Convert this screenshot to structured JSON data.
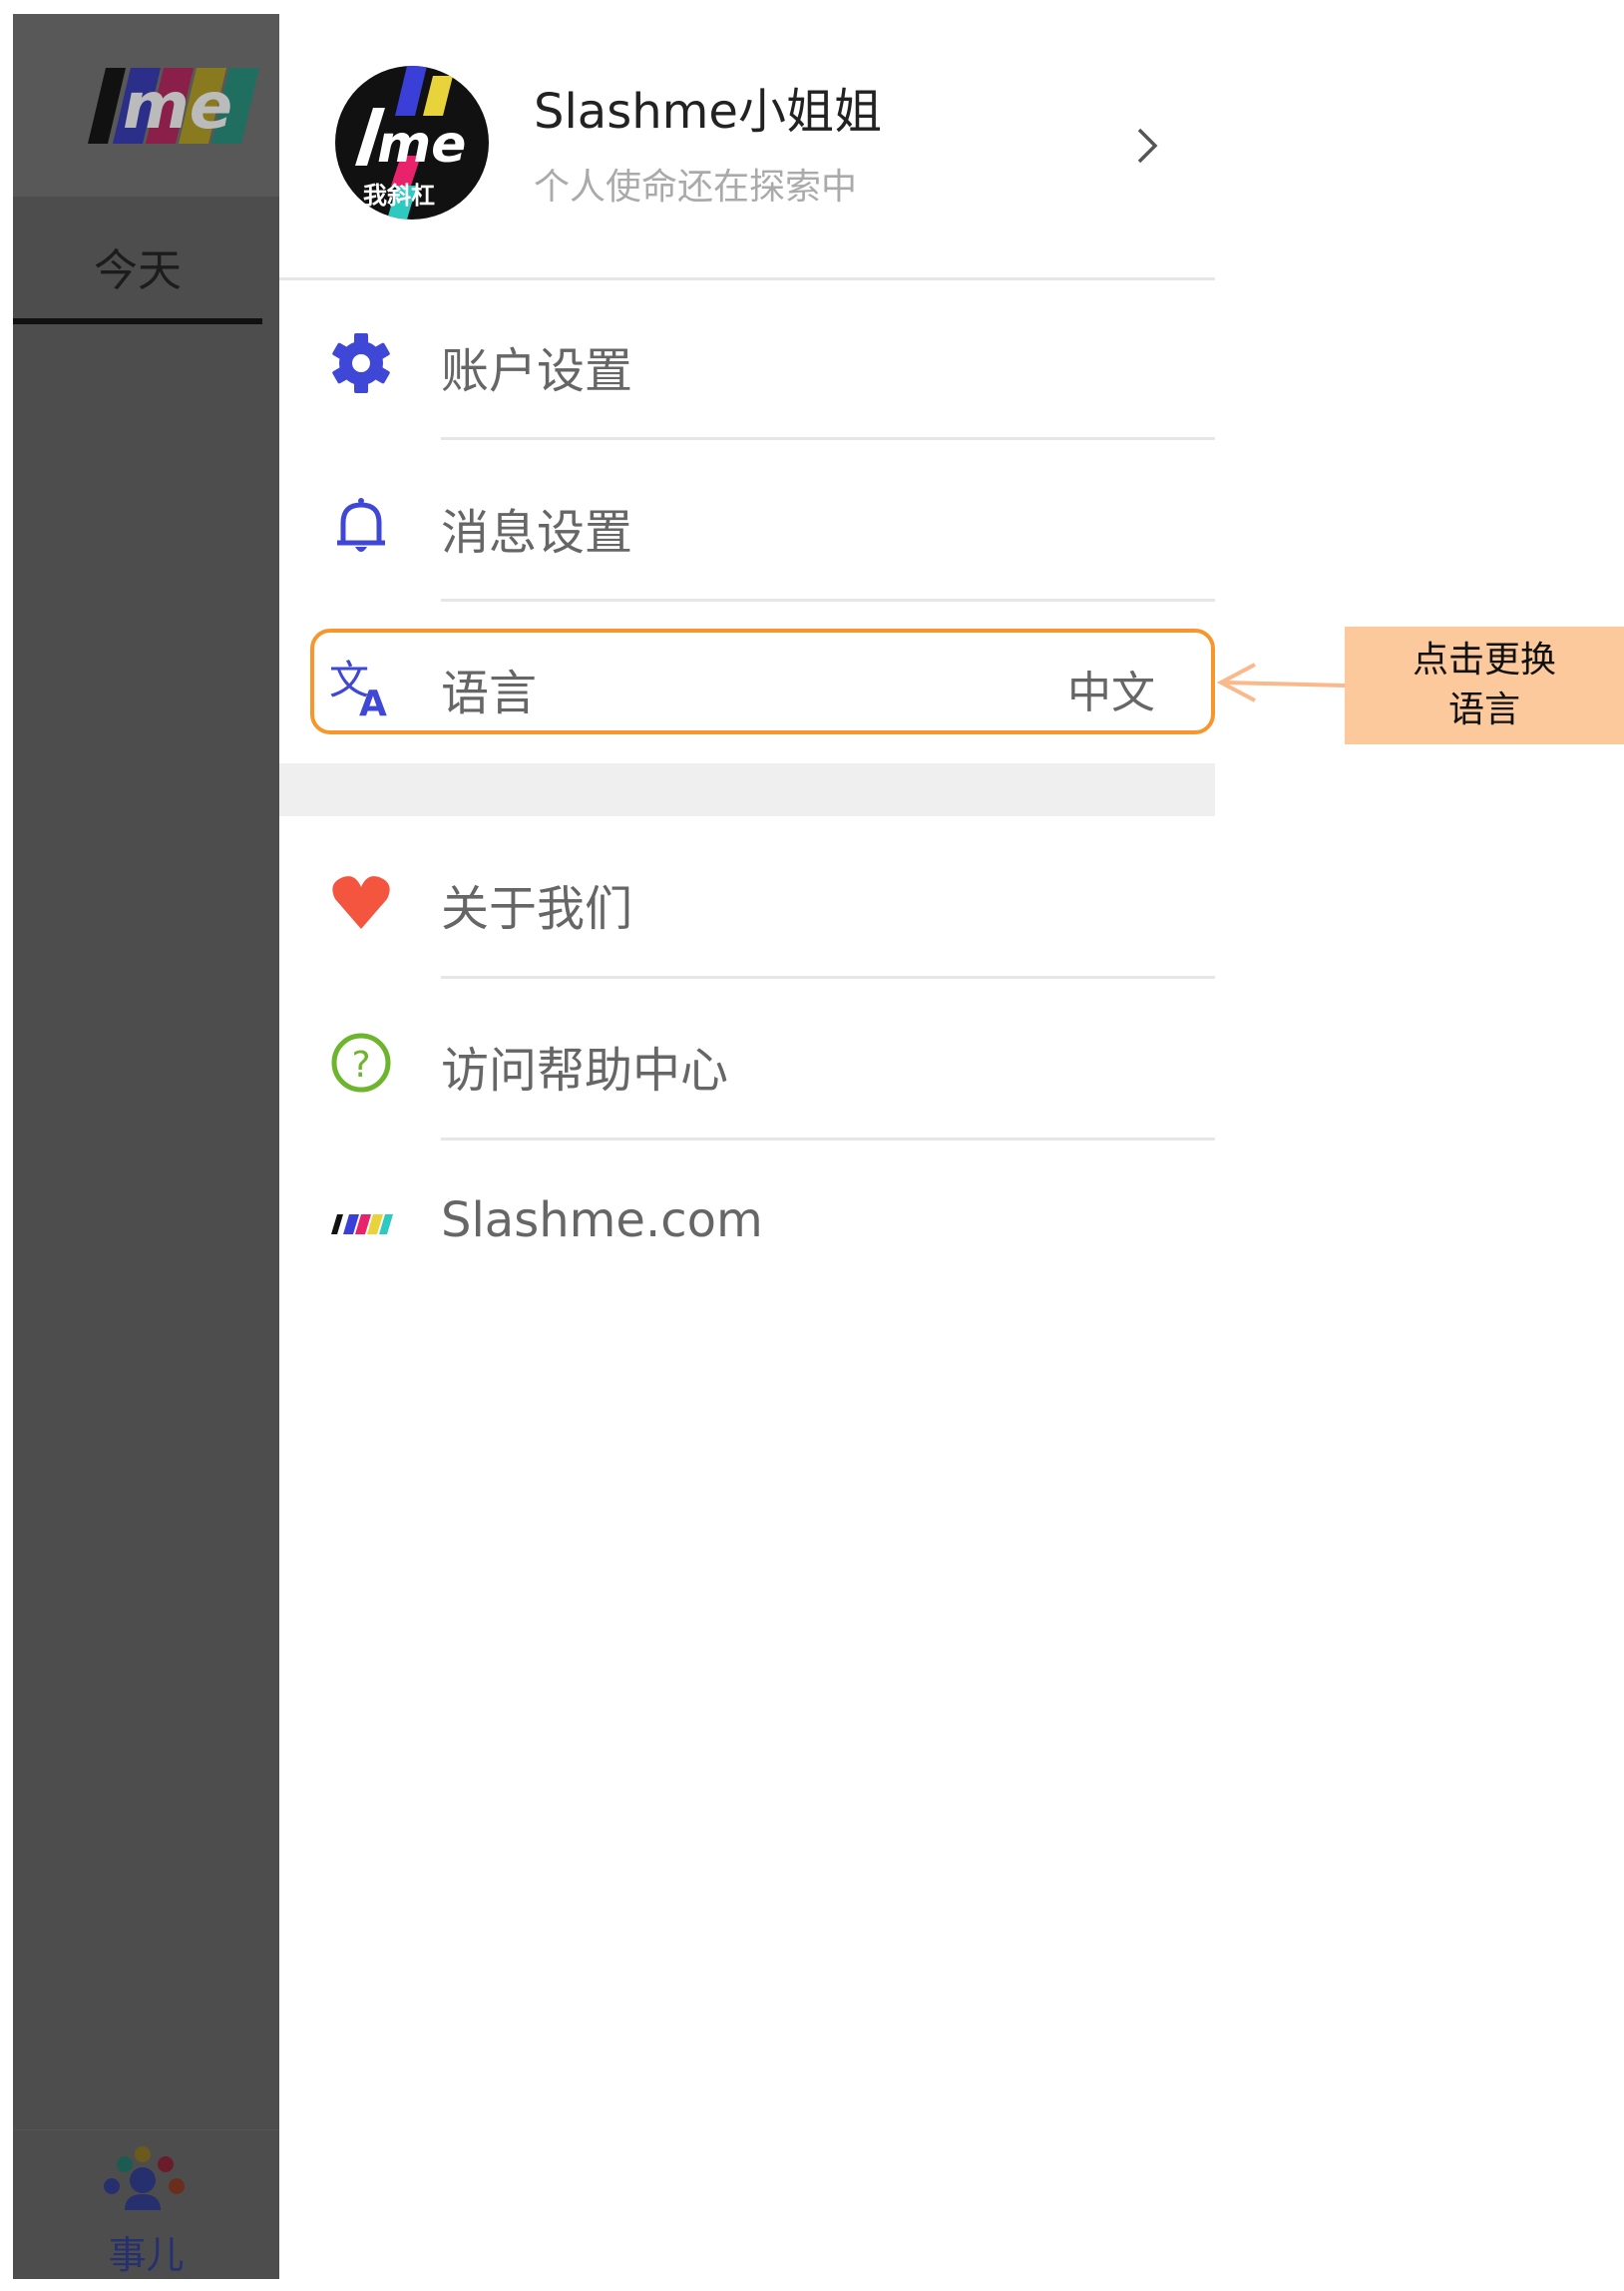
{
  "app": {
    "logo_text": "/me",
    "tab_today": "今天",
    "bottom_nav_label": "事儿"
  },
  "profile": {
    "name": "Slashme小姐姐",
    "subtitle": "个人使命还在探索中",
    "avatar_text": "我斜杠"
  },
  "menu": [
    {
      "icon": "gear-icon",
      "label": "账户设置",
      "icon_color": "#3f47d6"
    },
    {
      "icon": "bell-icon",
      "label": "消息设置",
      "icon_color": "#3f47d6"
    },
    {
      "icon": "translate-icon",
      "label": "语言",
      "value": "中文",
      "icon_color": "#3f47d6"
    },
    {
      "icon": "heart-icon",
      "label": "关于我们",
      "icon_color": "#f4553f"
    },
    {
      "icon": "help-circle-icon",
      "label": "访问帮助中心",
      "icon_color": "#6cb52c"
    },
    {
      "icon": "slashme-logo-icon",
      "label": "Slashme.com"
    }
  ],
  "annotation": {
    "line1": "点击更换",
    "line2": "语言",
    "highlight_color": "#f7962c",
    "callout_color": "#fbc99b"
  }
}
